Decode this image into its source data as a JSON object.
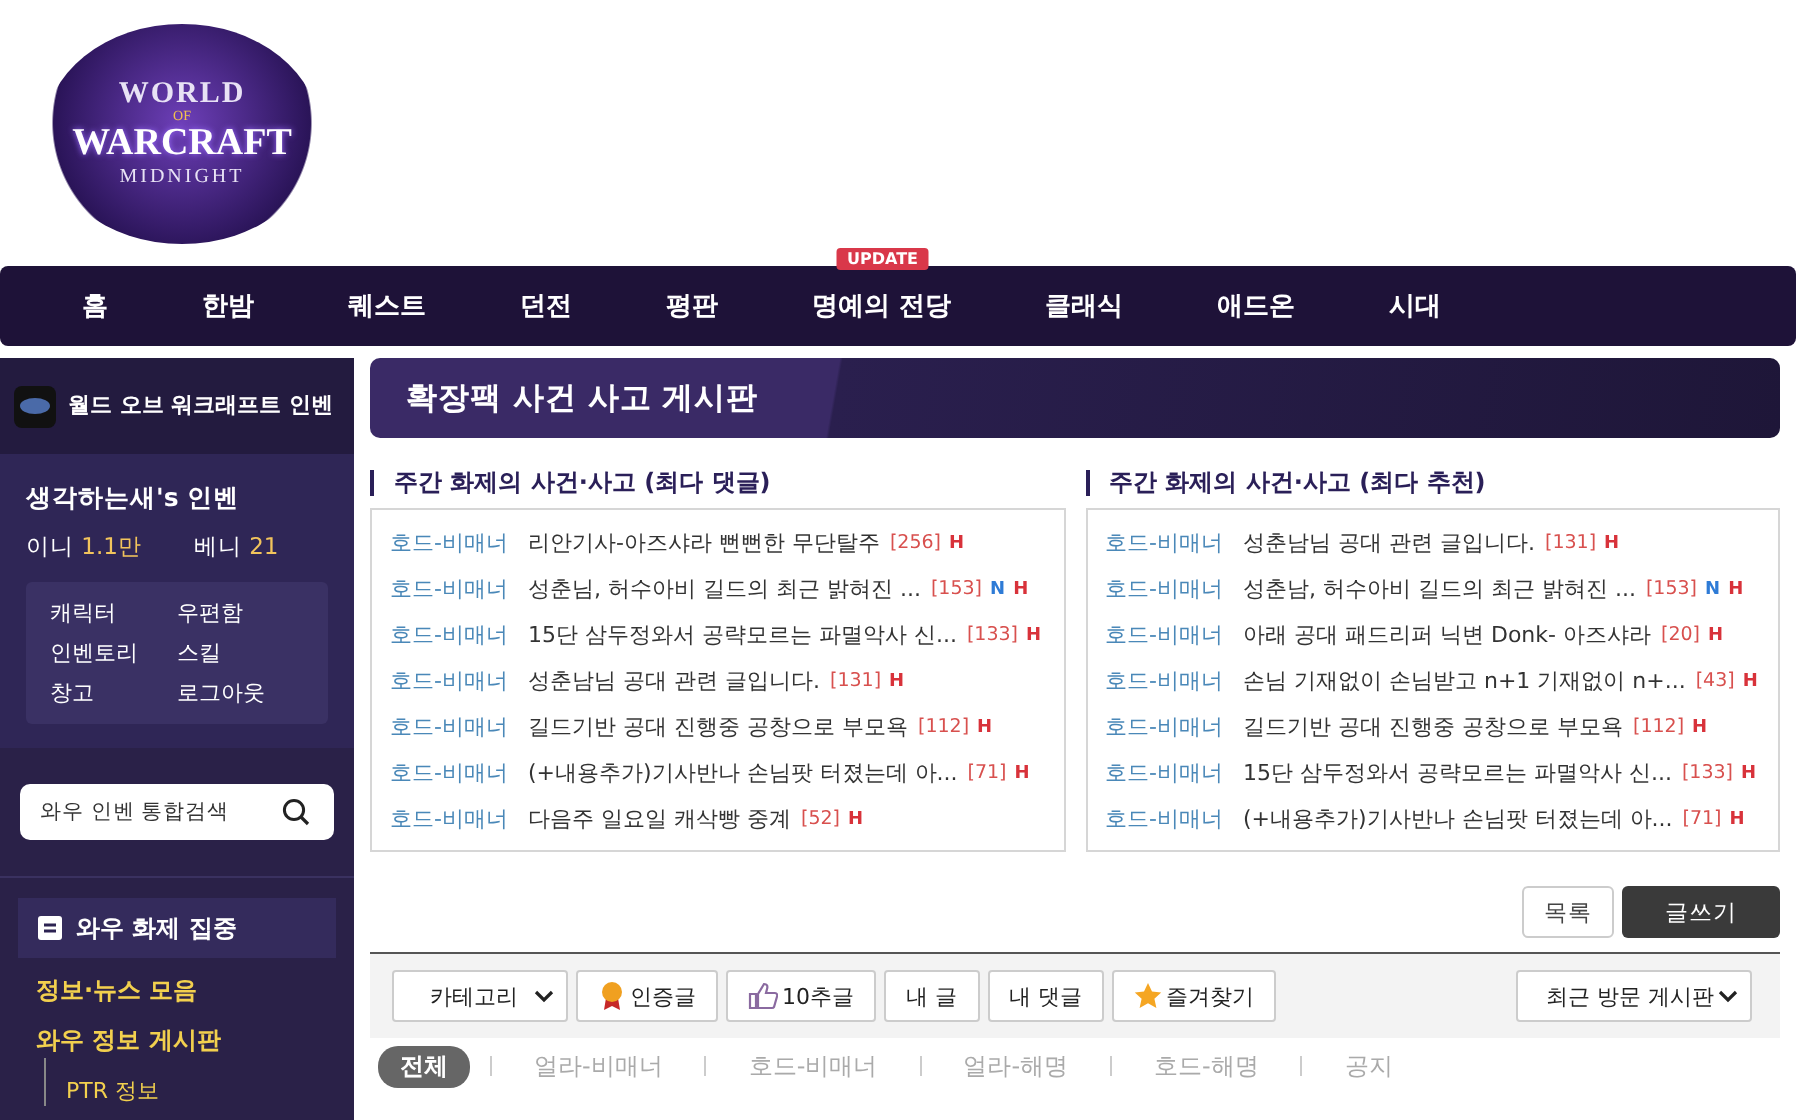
{
  "logo": {
    "top": "WORLD",
    "of": "OF",
    "main": "WARCRAFT",
    "sub": "MIDNIGHT"
  },
  "nav": [
    {
      "label": "홈"
    },
    {
      "label": "한밤"
    },
    {
      "label": "퀘스트"
    },
    {
      "label": "던전"
    },
    {
      "label": "평판"
    },
    {
      "label": "명예의 전당",
      "badge": "UPDATE"
    },
    {
      "label": "클래식"
    },
    {
      "label": "애드온"
    },
    {
      "label": "시대"
    }
  ],
  "sidebar": {
    "site_title": "월드 오브 워크래프트 인벤",
    "user": {
      "name": "생각하는새's 인벤",
      "stats": [
        {
          "label": "이니",
          "value": "1.1만"
        },
        {
          "label": "베니",
          "value": "21"
        }
      ],
      "links": [
        "캐릭터",
        "우편함",
        "인벤토리",
        "스킬",
        "창고",
        "로그아웃"
      ]
    },
    "search": {
      "placeholder": "와우 인벤 통합검색"
    },
    "section_title": "와우 화제 집중",
    "items": [
      {
        "label": "정보·뉴스 모음"
      },
      {
        "label": "와우 정보 게시판",
        "children": [
          {
            "label": "PTR 정보"
          }
        ]
      }
    ]
  },
  "board_title": "확장팩 사건 사고 게시판",
  "lists": [
    {
      "heading": "주간 화제의 사건·사고 (최다 댓글)",
      "posts": [
        {
          "category": "호드-비매너",
          "title": "리안기사-아즈샤라 뻔뻔한 무단탈주",
          "count": "[256]",
          "marks": [
            {
              "kind": "hot",
              "text": "H"
            }
          ]
        },
        {
          "category": "호드-비매너",
          "title": "성춘님, 허수아비 길드의 최근 밝혀진 ...",
          "count": "[153]",
          "marks": [
            {
              "kind": "new",
              "text": "N"
            },
            {
              "kind": "hot",
              "text": "H"
            }
          ]
        },
        {
          "category": "호드-비매너",
          "title": "15단 삼두정와서 공략모르는 파멸악사 신...",
          "count": "[133]",
          "marks": [
            {
              "kind": "hot",
              "text": "H"
            }
          ]
        },
        {
          "category": "호드-비매너",
          "title": "성춘남님 공대 관련 글입니다.",
          "count": "[131]",
          "marks": [
            {
              "kind": "hot",
              "text": "H"
            }
          ]
        },
        {
          "category": "호드-비매너",
          "title": "길드기반 공대 진행중 공창으로 부모욕",
          "count": "[112]",
          "marks": [
            {
              "kind": "hot",
              "text": "H"
            }
          ]
        },
        {
          "category": "호드-비매너",
          "title": "(+내용추가)기사반나 손님팟 터졌는데 아...",
          "count": "[71]",
          "marks": [
            {
              "kind": "hot",
              "text": "H"
            }
          ]
        },
        {
          "category": "호드-비매너",
          "title": "다음주 일요일 캐삭빵 중계",
          "count": "[52]",
          "marks": [
            {
              "kind": "hot",
              "text": "H"
            }
          ]
        }
      ]
    },
    {
      "heading": "주간 화제의 사건·사고 (최다 추천)",
      "posts": [
        {
          "category": "호드-비매너",
          "title": "성춘남님 공대 관련 글입니다.",
          "count": "[131]",
          "marks": [
            {
              "kind": "hot",
              "text": "H"
            }
          ]
        },
        {
          "category": "호드-비매너",
          "title": "성춘남, 허수아비 길드의 최근 밝혀진 ...",
          "count": "[153]",
          "marks": [
            {
              "kind": "new",
              "text": "N"
            },
            {
              "kind": "hot",
              "text": "H"
            }
          ]
        },
        {
          "category": "호드-비매너",
          "title": "아래 공대 패드리퍼 닉변 Donk- 아즈샤라",
          "count": "[20]",
          "marks": [
            {
              "kind": "hot",
              "text": "H"
            }
          ]
        },
        {
          "category": "호드-비매너",
          "title": "손님 기재없이 손님받고 n+1 기재없이 n+...",
          "count": "[43]",
          "marks": [
            {
              "kind": "hot",
              "text": "H"
            }
          ]
        },
        {
          "category": "호드-비매너",
          "title": "길드기반 공대 진행중 공창으로 부모욕",
          "count": "[112]",
          "marks": [
            {
              "kind": "hot",
              "text": "H"
            }
          ]
        },
        {
          "category": "호드-비매너",
          "title": "15단 삼두정와서 공략모르는 파멸악사 신...",
          "count": "[133]",
          "marks": [
            {
              "kind": "hot",
              "text": "H"
            }
          ]
        },
        {
          "category": "호드-비매너",
          "title": "(+내용추가)기사반나 손님팟 터졌는데 아...",
          "count": "[71]",
          "marks": [
            {
              "kind": "hot",
              "text": "H"
            }
          ]
        }
      ]
    }
  ],
  "actions": [
    {
      "label": "목록",
      "kind": "plain"
    },
    {
      "label": "글쓰기",
      "kind": "primary"
    }
  ],
  "toolbar": {
    "category_select": "카테고리",
    "buttons": [
      {
        "label": "인증글",
        "kind": "medal"
      },
      {
        "label": "10추글",
        "kind": "thumb"
      },
      {
        "label": "내 글",
        "kind": "plain"
      },
      {
        "label": "내 댓글",
        "kind": "plain"
      },
      {
        "label": "즐겨찾기",
        "kind": "star"
      }
    ],
    "recent_select": "최근 방문 게시판"
  },
  "tabs": [
    {
      "label": "전체",
      "selected": true
    },
    {
      "label": "얼라-비매너",
      "selected": false
    },
    {
      "label": "호드-비매너",
      "selected": false
    },
    {
      "label": "얼라-해명",
      "selected": false
    },
    {
      "label": "호드-해명",
      "selected": false
    },
    {
      "label": "공지",
      "selected": false
    }
  ]
}
